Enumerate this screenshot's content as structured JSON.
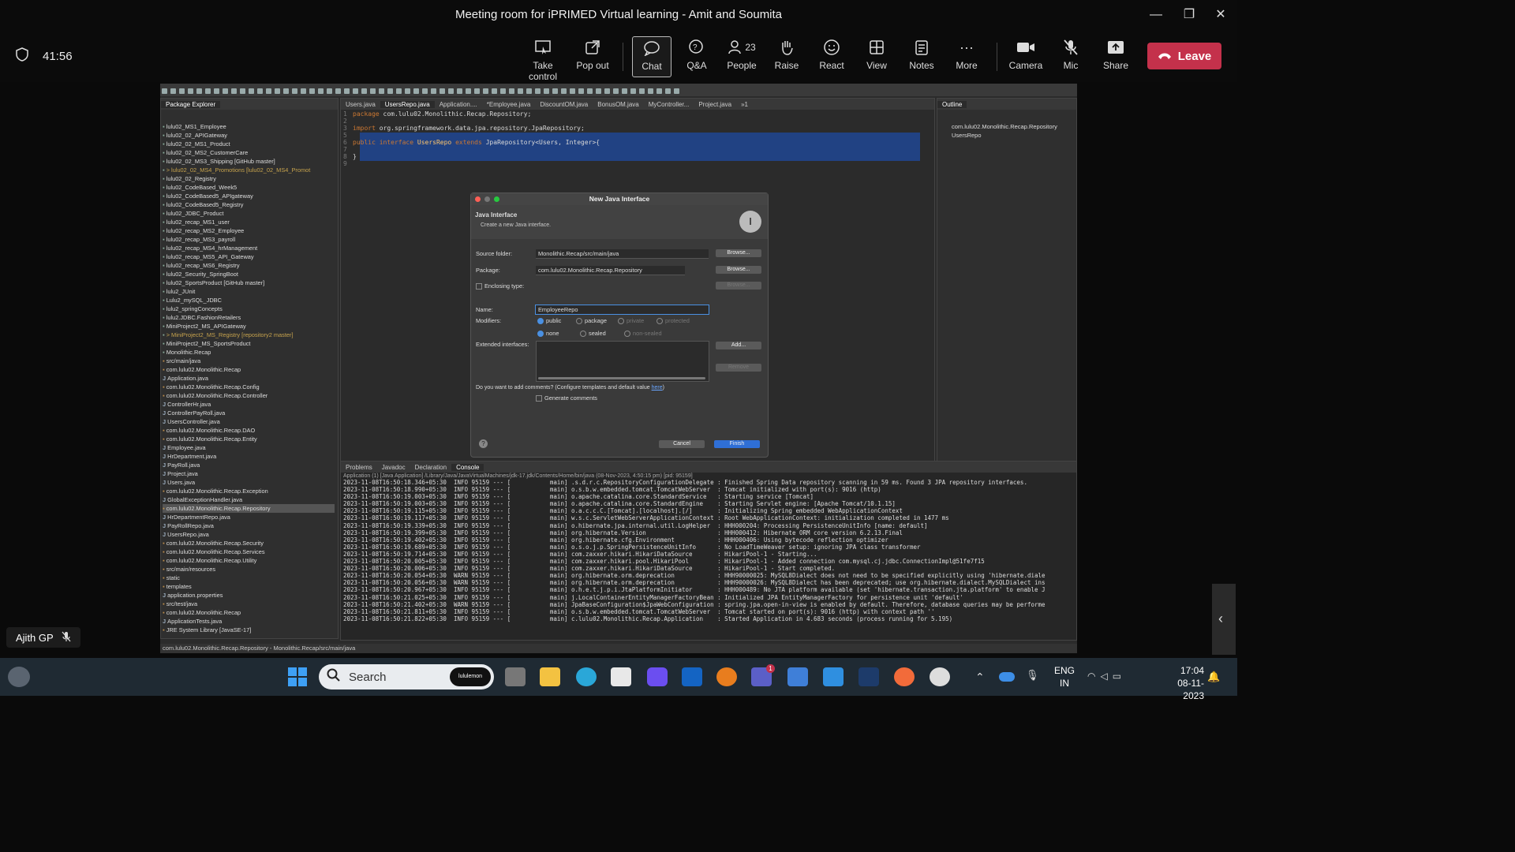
{
  "window": {
    "title": "Meeting room for iPRIMED Virtual learning - Amit and Soumita"
  },
  "meeting": {
    "timer": "41:56",
    "toolbar": [
      {
        "label": "Take control",
        "icon": "take-control-icon"
      },
      {
        "label": "Pop out",
        "icon": "pop-out-icon"
      },
      {
        "label": "Chat",
        "icon": "chat-icon"
      },
      {
        "label": "Q&A",
        "icon": "qa-icon"
      },
      {
        "label": "People",
        "icon": "people-icon",
        "count": "23"
      },
      {
        "label": "Raise",
        "icon": "raise-hand-icon"
      },
      {
        "label": "React",
        "icon": "react-icon"
      },
      {
        "label": "View",
        "icon": "view-icon"
      },
      {
        "label": "Notes",
        "icon": "notes-icon"
      },
      {
        "label": "More",
        "icon": "more-icon"
      },
      {
        "label": "Camera",
        "icon": "camera-icon"
      },
      {
        "label": "Mic",
        "icon": "mic-muted-icon"
      },
      {
        "label": "Share",
        "icon": "share-icon"
      }
    ],
    "leave_label": "Leave",
    "participant_name": "Ajith GP"
  },
  "eclipse": {
    "package_explorer_tab": "Package Explorer",
    "outline_tab": "Outline",
    "editor_tabs": [
      "Users.java",
      "UsersRepo.java",
      "Application....",
      "*Employee.java",
      "DiscountOM.java",
      "BonusOM.java",
      "MyController...",
      "Project.java",
      "»1"
    ],
    "outline_items": [
      "com.lulu02.Monolithic.Recap.Repository",
      "UsersRepo"
    ],
    "tree": [
      {
        "text": "lulu02_MS1_Employee",
        "cls": "proj"
      },
      {
        "text": "lulu02_02_APIGateway",
        "cls": "proj"
      },
      {
        "text": "lulu02_02_MS1_Product",
        "cls": "proj"
      },
      {
        "text": "lulu02_02_MS2_CustomerCare",
        "cls": "proj"
      },
      {
        "text": "lulu02_02_MS3_Shipping [GitHub master]",
        "cls": "proj"
      },
      {
        "text": "> lulu02_02_MS4_Promotions [lulu02_02_MS4_Promot",
        "cls": "proj git"
      },
      {
        "text": "lulu02_02_Registry",
        "cls": "proj"
      },
      {
        "text": "lulu02_CodeBased_Week5",
        "cls": "proj"
      },
      {
        "text": "lulu02_CodeBased5_APIgateway",
        "cls": "proj"
      },
      {
        "text": "lulu02_CodeBased5_Registry",
        "cls": "proj"
      },
      {
        "text": "lulu02_JDBC_Product",
        "cls": "proj"
      },
      {
        "text": "lulu02_recap_MS1_user",
        "cls": "proj"
      },
      {
        "text": "lulu02_recap_MS2_Employee",
        "cls": "proj"
      },
      {
        "text": "lulu02_recap_MS3_payroll",
        "cls": "proj"
      },
      {
        "text": "lulu02_recap_MS4_hrManagement",
        "cls": "proj"
      },
      {
        "text": "lulu02_recap_MS5_API_Gateway",
        "cls": "proj"
      },
      {
        "text": "lulu02_recap_MS6_Registry",
        "cls": "proj"
      },
      {
        "text": "lulu02_Security_SpringBoot",
        "cls": "proj"
      },
      {
        "text": "lulu02_SportsProduct [GitHub master]",
        "cls": "proj"
      },
      {
        "text": "lulu2_JUnit",
        "cls": "proj"
      },
      {
        "text": "Lulu2_mySQL_JDBC",
        "cls": "proj"
      },
      {
        "text": "lulu2_springConcepts",
        "cls": "proj"
      },
      {
        "text": "lulu2.JDBC.FashionRetailers",
        "cls": "proj"
      },
      {
        "text": "MiniProject2_MS_APIGateway",
        "cls": "proj"
      },
      {
        "text": "> MiniProject2_MS_Registry [repository2 master]",
        "cls": "proj git"
      },
      {
        "text": "MiniProject2_MS_SportsProduct",
        "cls": "proj"
      },
      {
        "text": "Monolithic.Recap",
        "cls": "proj"
      },
      {
        "text": "    src/main/java",
        "cls": "pkg"
      },
      {
        "text": "      com.lulu02.Monolithic.Recap",
        "cls": "pkg"
      },
      {
        "text": "          Application.java",
        "cls": "file"
      },
      {
        "text": "        com.lulu02.Monolithic.Recap.Config",
        "cls": "pkg"
      },
      {
        "text": "      com.lulu02.Monolithic.Recap.Controller",
        "cls": "pkg"
      },
      {
        "text": "          ControllerHr.java",
        "cls": "file"
      },
      {
        "text": "          ControllerPayRoll.java",
        "cls": "file"
      },
      {
        "text": "          UsersController.java",
        "cls": "file"
      },
      {
        "text": "        com.lulu02.Monolithic.Recap.DAO",
        "cls": "pkg"
      },
      {
        "text": "      com.lulu02.Monolithic.Recap.Entity",
        "cls": "pkg"
      },
      {
        "text": "          Employee.java",
        "cls": "file"
      },
      {
        "text": "          HrDepartment.java",
        "cls": "file"
      },
      {
        "text": "          PayRoll.java",
        "cls": "file"
      },
      {
        "text": "          Project.java",
        "cls": "file"
      },
      {
        "text": "          Users.java",
        "cls": "file"
      },
      {
        "text": "      com.lulu02.Monolithic.Recap.Exception",
        "cls": "pkg"
      },
      {
        "text": "          GlobalExceptionHandler.java",
        "cls": "file"
      },
      {
        "text": "      com.lulu02.Monolithic.Recap.Repository",
        "cls": "pkg sel"
      },
      {
        "text": "          HrDepartmentRepo.java",
        "cls": "file"
      },
      {
        "text": "          PayRollRepo.java",
        "cls": "file"
      },
      {
        "text": "          UsersRepo.java",
        "cls": "file"
      },
      {
        "text": "        com.lulu02.Monolithic.Recap.Security",
        "cls": "pkg"
      },
      {
        "text": "        com.lulu02.Monolithic.Recap.Services",
        "cls": "pkg"
      },
      {
        "text": "        com.lulu02.Monolithic.Recap.Utility",
        "cls": "pkg"
      },
      {
        "text": "    src/main/resources",
        "cls": "pkg"
      },
      {
        "text": "        static",
        "cls": "pkg"
      },
      {
        "text": "        templates",
        "cls": "pkg"
      },
      {
        "text": "        application.properties",
        "cls": "file"
      },
      {
        "text": "    src/test/java",
        "cls": "pkg"
      },
      {
        "text": "      com.lulu02.Monolithic.Recap",
        "cls": "pkg"
      },
      {
        "text": "          ApplicationTests.java",
        "cls": "file"
      },
      {
        "text": "    JRE System Library [JavaSE-17]",
        "cls": "pkg"
      }
    ],
    "code_lines": [
      {
        "n": "1",
        "html": "<span class='kw'>package</span> com.lulu02.Monolithic.Recap.Repository;"
      },
      {
        "n": "2",
        "html": ""
      },
      {
        "n": "3",
        "html": "<span class='kw'>import</span> org.springframework.data.jpa.repository.JpaRepository;"
      },
      {
        "n": "5",
        "html": ""
      },
      {
        "n": "6",
        "html": "<span class='kw'>public interface</span> <span class='ty'>UsersRepo</span> <span class='kw'>extends</span> JpaRepository&lt;Users, Integer&gt;{"
      },
      {
        "n": "7",
        "html": ""
      },
      {
        "n": "8",
        "html": "}"
      },
      {
        "n": "9",
        "html": ""
      }
    ],
    "dialog": {
      "title": "New Java Interface",
      "heading": "Java Interface",
      "subheading": "Create a new Java interface.",
      "source_folder_label": "Source folder:",
      "source_folder_value": "Monolithic.Recap/src/main/java",
      "package_label": "Package:",
      "package_value": "com.lulu02.Monolithic.Recap.Repository",
      "enclosing_label": "Enclosing type:",
      "browse": "Browse...",
      "name_label": "Name:",
      "name_value": "EmployeeRepo",
      "modifiers_label": "Modifiers:",
      "mod_public": "public",
      "mod_package": "package",
      "mod_private": "private",
      "mod_protected": "protected",
      "mod_none": "none",
      "mod_sealed": "sealed",
      "mod_nonsealed": "non-sealed",
      "extended_label": "Extended interfaces:",
      "add": "Add...",
      "remove": "Remove",
      "comments_question": "Do you want to add comments? (Configure templates and default value",
      "comments_link": "here",
      "generate_comments": "Generate comments",
      "cancel": "Cancel",
      "finish": "Finish"
    },
    "console_tabs": [
      "Problems",
      "Javadoc",
      "Declaration",
      "Console"
    ],
    "console_header": "Application (1) [Java Application] /Library/Java/JavaVirtualMachines/jdk-17.jdk/Contents/Home/bin/java  (08-Nov-2023, 4:50:15 pm) [pid: 95159]",
    "console_lines": [
      "2023-11-08T16:50:18.346+05:30  INFO 95159 --- [           main] .s.d.r.c.RepositoryConfigurationDelegate : Finished Spring Data repository scanning in 59 ms. Found 3 JPA repository interfaces.",
      "2023-11-08T16:50:18.990+05:30  INFO 95159 --- [           main] o.s.b.w.embedded.tomcat.TomcatWebServer  : Tomcat initialized with port(s): 9016 (http)",
      "2023-11-08T16:50:19.003+05:30  INFO 95159 --- [           main] o.apache.catalina.core.StandardService   : Starting service [Tomcat]",
      "2023-11-08T16:50:19.003+05:30  INFO 95159 --- [           main] o.apache.catalina.core.StandardEngine    : Starting Servlet engine: [Apache Tomcat/10.1.15]",
      "2023-11-08T16:50:19.115+05:30  INFO 95159 --- [           main] o.a.c.c.C.[Tomcat].[localhost].[/]       : Initializing Spring embedded WebApplicationContext",
      "2023-11-08T16:50:19.117+05:30  INFO 95159 --- [           main] w.s.c.ServletWebServerApplicationContext : Root WebApplicationContext: initialization completed in 1477 ms",
      "2023-11-08T16:50:19.339+05:30  INFO 95159 --- [           main] o.hibernate.jpa.internal.util.LogHelper  : HHH000204: Processing PersistenceUnitInfo [name: default]",
      "2023-11-08T16:50:19.399+05:30  INFO 95159 --- [           main] org.hibernate.Version                    : HHH000412: Hibernate ORM core version 6.2.13.Final",
      "2023-11-08T16:50:19.402+05:30  INFO 95159 --- [           main] org.hibernate.cfg.Environment            : HHH000406: Using bytecode reflection optimizer",
      "2023-11-08T16:50:19.689+05:30  INFO 95159 --- [           main] o.s.o.j.p.SpringPersistenceUnitInfo      : No LoadTimeWeaver setup: ignoring JPA class transformer",
      "2023-11-08T16:50:19.714+05:30  INFO 95159 --- [           main] com.zaxxer.hikari.HikariDataSource       : HikariPool-1 - Starting...",
      "2023-11-08T16:50:20.005+05:30  INFO 95159 --- [           main] com.zaxxer.hikari.pool.HikariPool        : HikariPool-1 - Added connection com.mysql.cj.jdbc.ConnectionImpl@51fe7f15",
      "2023-11-08T16:50:20.006+05:30  INFO 95159 --- [           main] com.zaxxer.hikari.HikariDataSource       : HikariPool-1 - Start completed.",
      "2023-11-08T16:50:20.054+05:30  WARN 95159 --- [           main] org.hibernate.orm.deprecation            : HHH90000025: MySQL8Dialect does not need to be specified explicitly using 'hibernate.diale",
      "2023-11-08T16:50:20.056+05:30  WARN 95159 --- [           main] org.hibernate.orm.deprecation            : HHH90000026: MySQL8Dialect has been deprecated; use org.hibernate.dialect.MySQLDialect ins",
      "2023-11-08T16:50:20.967+05:30  INFO 95159 --- [           main] o.h.e.t.j.p.i.JtaPlatformInitiator       : HHH000489: No JTA platform available (set 'hibernate.transaction.jta.platform' to enable J",
      "2023-11-08T16:50:21.025+05:30  INFO 95159 --- [           main] j.LocalContainerEntityManagerFactoryBean : Initialized JPA EntityManagerFactory for persistence unit 'default'",
      "2023-11-08T16:50:21.402+05:30  WARN 95159 --- [           main] JpaBaseConfiguration$JpaWebConfiguration : spring.jpa.open-in-view is enabled by default. Therefore, database queries may be performe",
      "2023-11-08T16:50:21.811+05:30  INFO 95159 --- [           main] o.s.b.w.embedded.tomcat.TomcatWebServer  : Tomcat started on port(s): 9016 (http) with context path ''",
      "2023-11-08T16:50:21.822+05:30  INFO 95159 --- [           main] c.lulu02.Monolithic.Recap.Application    : Started Application in 4.683 seconds (process running for 5.195)"
    ],
    "status_bar": "com.lulu02.Monolithic.Recap.Repository - Monolithic.Recap/src/main/java"
  },
  "taskbar": {
    "search_placeholder": "Search",
    "search_badge": "lululemon",
    "lang_top": "ENG",
    "lang_bottom": "IN",
    "time": "17:04",
    "date": "08-11-2023",
    "teams_badge": "1"
  }
}
